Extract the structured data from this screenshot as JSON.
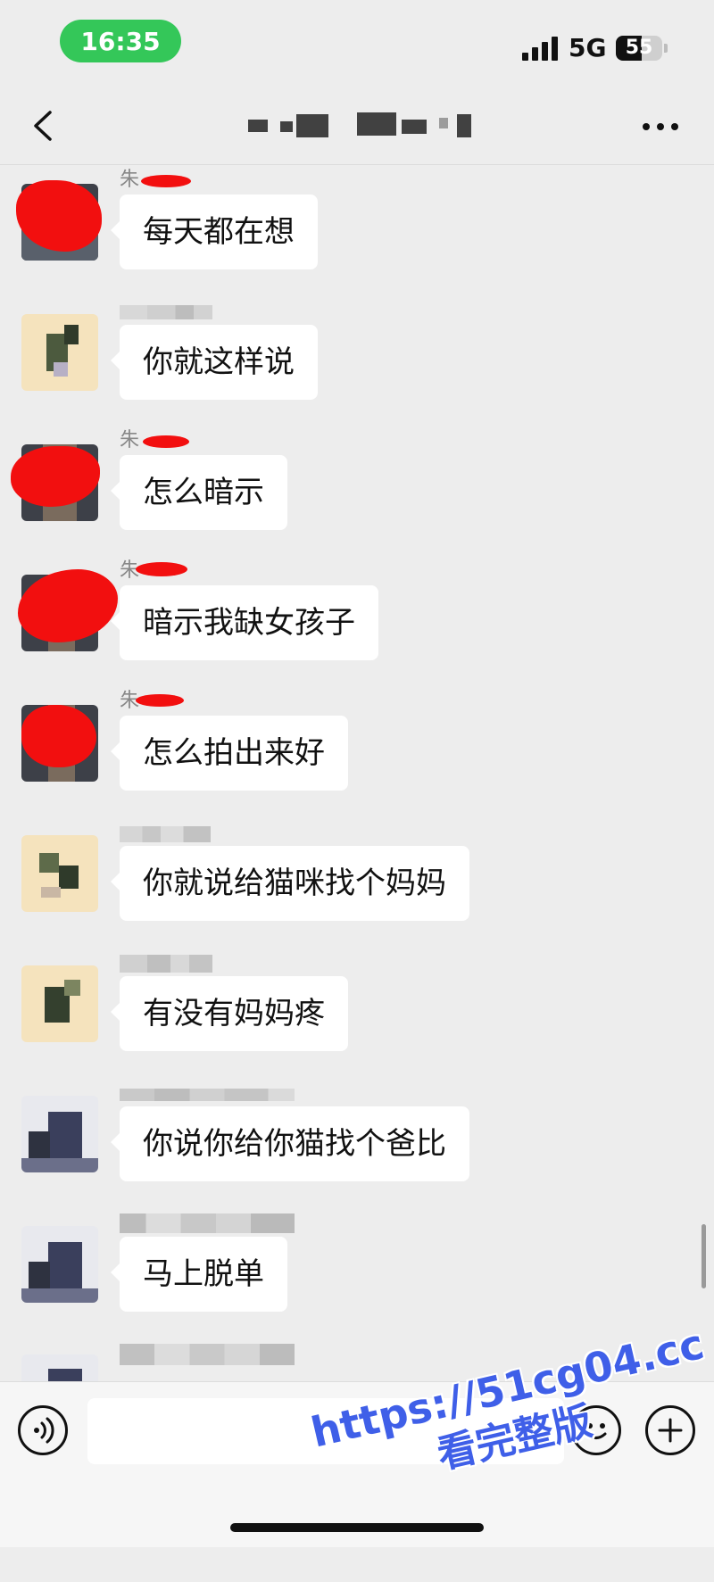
{
  "status_bar": {
    "time": "16:35",
    "network": "5G",
    "battery_level": "55"
  },
  "nav": {
    "title": ""
  },
  "messages": [
    {
      "sender": "朱",
      "text": "每天都在想"
    },
    {
      "sender": "",
      "text": "你就这样说"
    },
    {
      "sender": "朱",
      "text": "怎么暗示"
    },
    {
      "sender": "朱",
      "text": "暗示我缺女孩子"
    },
    {
      "sender": "朱",
      "text": "怎么拍出来好"
    },
    {
      "sender": "",
      "text": "你就说给猫咪找个妈妈"
    },
    {
      "sender": "",
      "text": "有没有妈妈疼"
    },
    {
      "sender": "",
      "text": "你说你给你猫找个爸比"
    },
    {
      "sender": "",
      "text": "马上脱单"
    }
  ],
  "input": {
    "value": "",
    "placeholder": ""
  },
  "watermark": {
    "url": "https://51cg04.cc",
    "text": "看完整版"
  },
  "colors": {
    "background": "#ededed",
    "bubble": "#ffffff",
    "time_pill": "#34c759",
    "redaction": "#f20f0f",
    "watermark": "#3f5fe8"
  },
  "icons": [
    "back-icon",
    "more-icon",
    "voice-icon",
    "emoji-icon",
    "add-icon"
  ]
}
